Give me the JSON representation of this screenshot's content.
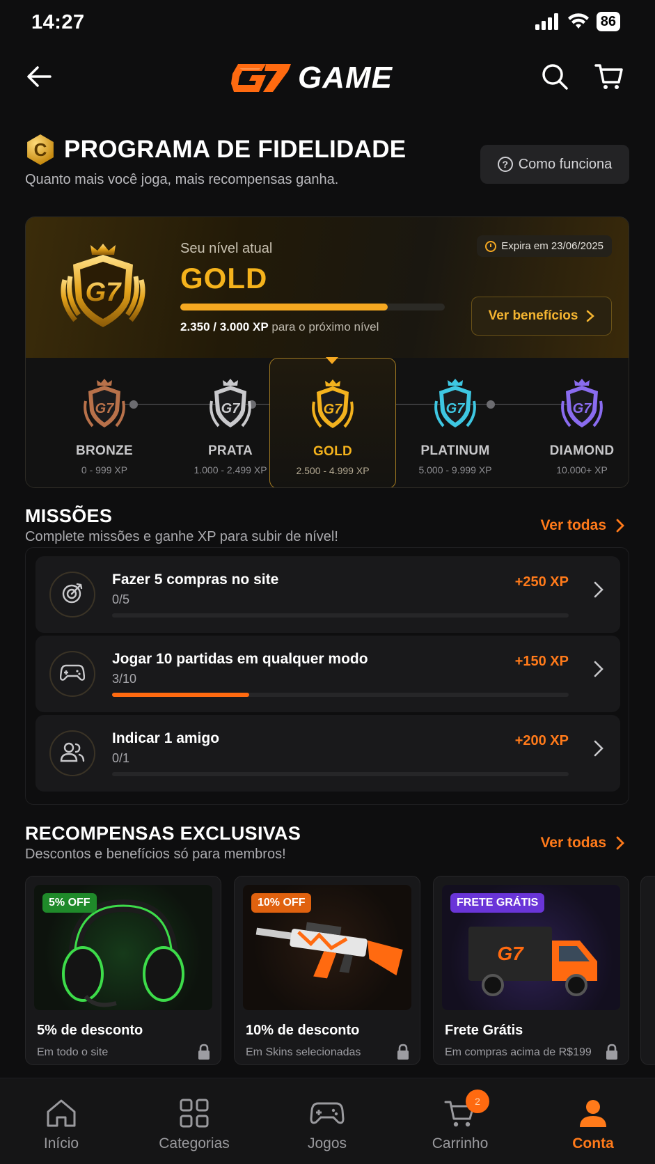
{
  "status": {
    "time": "14:27",
    "battery": "86"
  },
  "header": {
    "logo_text": "GAME",
    "logo_mark": "G7"
  },
  "page": {
    "title": "PROGRAMA DE FIDELIDADE",
    "subtitle": "Quanto mais você joga, mais recompensas ganha.",
    "how_label": "Como funciona"
  },
  "level": {
    "label": "Seu nível atual",
    "name": "GOLD",
    "progress": 0.783,
    "xp_current": "2.350 / 3.000 XP",
    "xp_suffix": "para o próximo nível",
    "expires": "Expira em 23/06/2025",
    "benefits_label": "Ver benefícios"
  },
  "tiers": [
    {
      "name": "BRONZE",
      "range": "0 - 999 XP",
      "color": "#b8714a"
    },
    {
      "name": "PRATA",
      "range": "1.000 - 2.499 XP",
      "color": "#c9c9cc"
    },
    {
      "name": "GOLD",
      "range": "2.500 - 4.999 XP",
      "color": "#f3b21e"
    },
    {
      "name": "PLATINUM",
      "range": "5.000 - 9.999 XP",
      "color": "#3ec7e2"
    },
    {
      "name": "DIAMOND",
      "range": "10.000+ XP",
      "color": "#8a6cf0"
    }
  ],
  "missions": {
    "title": "MISSÕES",
    "subtitle": "Complete missões e ganhe XP para subir de nível!",
    "see_all": "Ver todas",
    "items": [
      {
        "title": "Fazer 5 compras no site",
        "progress": "0/5",
        "xp": "+250 XP",
        "fraction": 0,
        "icon": "target-icon"
      },
      {
        "title": "Jogar 10 partidas em qualquer modo",
        "progress": "3/10",
        "xp": "+150 XP",
        "fraction": 0.3,
        "icon": "gamepad-icon"
      },
      {
        "title": "Indicar 1 amigo",
        "progress": "0/1",
        "xp": "+200 XP",
        "fraction": 0,
        "icon": "users-icon"
      }
    ]
  },
  "rewards": {
    "title": "RECOMPENSAS EXCLUSIVAS",
    "subtitle": "Descontos e benefícios só para membros!",
    "see_all": "Ver todas",
    "items": [
      {
        "tag": "5% OFF",
        "tag_color": "#1f8a2a",
        "title": "5% de desconto",
        "sub": "Em todo o site",
        "icon": "headset-icon"
      },
      {
        "tag": "10% OFF",
        "tag_color": "#e0620f",
        "title": "10% de desconto",
        "sub": "Em Skins selecionadas",
        "icon": "rifle-icon"
      },
      {
        "tag": "FRETE GRÁTIS",
        "tag_color": "#6a35d8",
        "title": "Frete Grátis",
        "sub": "Em compras acima de R$199",
        "icon": "truck-icon"
      }
    ]
  },
  "nav": {
    "items": [
      {
        "label": "Início",
        "icon": "home-icon"
      },
      {
        "label": "Categorias",
        "icon": "grid-icon"
      },
      {
        "label": "Jogos",
        "icon": "gamepad-icon"
      },
      {
        "label": "Carrinho",
        "icon": "cart-icon",
        "badge": "2"
      },
      {
        "label": "Conta",
        "icon": "user-icon"
      }
    ]
  }
}
